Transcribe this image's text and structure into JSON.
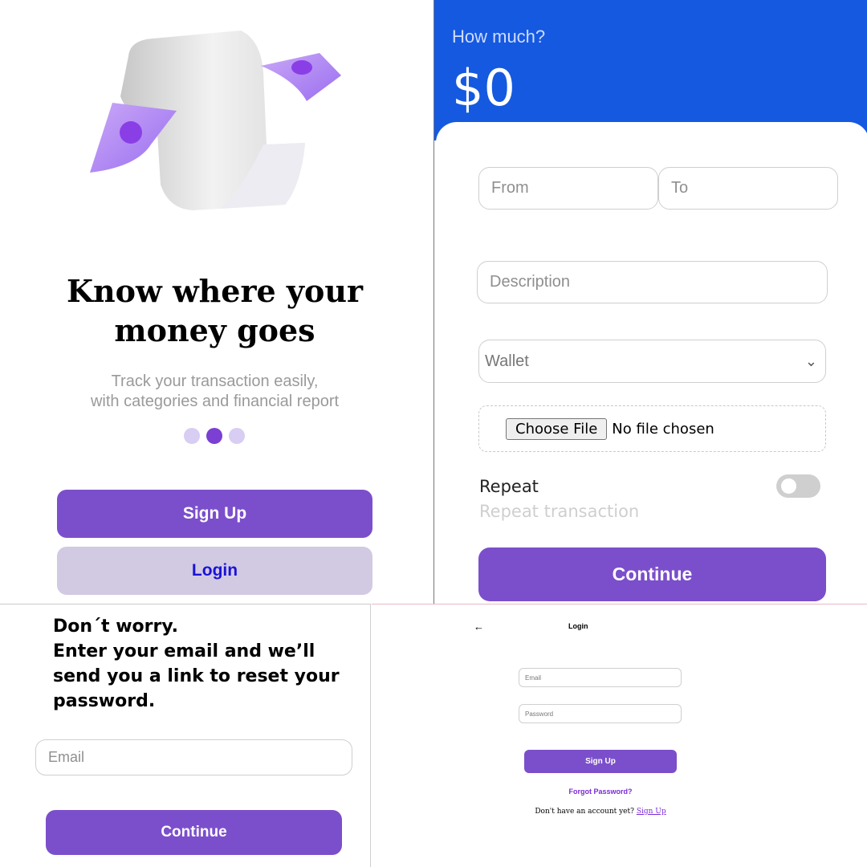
{
  "onboarding": {
    "title_lines": [
      "Know where your",
      "money goes"
    ],
    "subtitle_lines": [
      "Track your transaction easily,",
      "with categories and financial report"
    ],
    "pager": {
      "count": 3,
      "active_index": 1
    },
    "signup_label": "Sign Up",
    "login_label": "Login",
    "illustration_icon": "receipt-money-illustration",
    "colors": {
      "primary": "#7b4fcb",
      "secondary": "#d2c9e3",
      "login_text": "#1a13d6",
      "dot_active": "#7b3fd3",
      "dot_inactive": "#d8cdf2"
    }
  },
  "expense": {
    "question": "How much?",
    "amount": "$0",
    "from_placeholder": "From",
    "to_placeholder": "To",
    "description_placeholder": "Description",
    "wallet_selected": "Wallet",
    "file_button_label": "Choose File",
    "file_status": "No file chosen",
    "repeat_label": "Repeat",
    "repeat_sublabel": "Repeat transaction",
    "repeat_enabled": false,
    "continue_label": "Continue",
    "colors": {
      "header": "#1559e0",
      "primary": "#7b4fcb"
    }
  },
  "forgot": {
    "message_lines": [
      "Don´t worry.",
      "Enter your email and we’ll",
      "send you a link to reset your",
      "password."
    ],
    "email_placeholder": "Email",
    "continue_label": "Continue"
  },
  "login": {
    "back_icon": "arrow-left-icon",
    "back_glyph": "←",
    "title": "Login",
    "email_placeholder": "Email",
    "password_placeholder": "Password",
    "signup_label": "Sign Up",
    "forgot_label": "Forgot Password?",
    "account_prompt": "Don't have an account yet?",
    "account_link": "Sign Up",
    "colors": {
      "primary": "#7b4fcb",
      "link": "#7a2ad9"
    }
  }
}
